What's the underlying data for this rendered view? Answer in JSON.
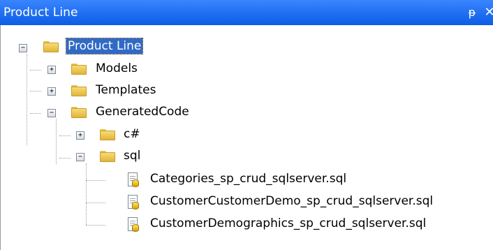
{
  "window": {
    "title": "Product Line",
    "pin_glyph": "ᵽ",
    "close_glyph": "✕"
  },
  "tree": {
    "root": {
      "label": "Product Line",
      "expander": "−"
    },
    "models": {
      "label": "Models",
      "expander": "+"
    },
    "templates": {
      "label": "Templates",
      "expander": "+"
    },
    "generated": {
      "label": "GeneratedCode",
      "expander": "−"
    },
    "csharp": {
      "label": "c#",
      "expander": "+"
    },
    "sql": {
      "label": "sql",
      "expander": "−"
    },
    "files": [
      {
        "label": "Categories_sp_crud_sqlserver.sql"
      },
      {
        "label": "CustomerCustomerDemo_sp_crud_sqlserver.sql"
      },
      {
        "label": "CustomerDemographics_sp_crud_sqlserver.sql"
      }
    ]
  },
  "icons": {
    "folder": "folder-icon",
    "sql_file": "sql-file-icon",
    "pin": "pin-icon",
    "close": "close-icon"
  }
}
